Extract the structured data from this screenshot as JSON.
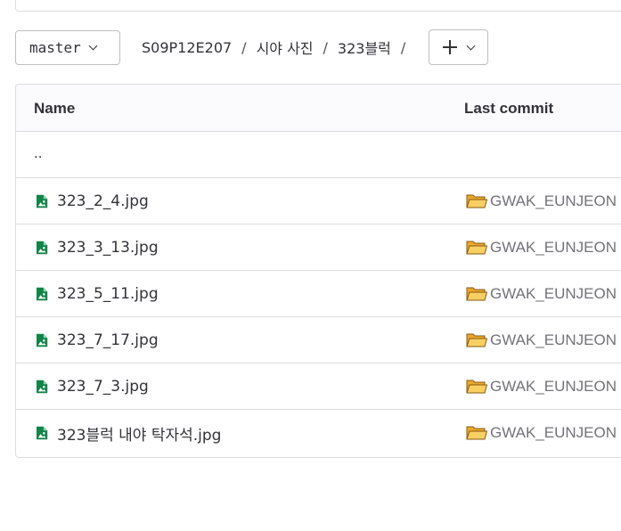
{
  "toolbar": {
    "branch": "master",
    "breadcrumb": [
      "S09P12E207",
      "시야 사진",
      "323블럭"
    ],
    "separator": "/"
  },
  "table": {
    "headers": {
      "name": "Name",
      "last_commit": "Last commit"
    },
    "parent_row": "..",
    "files": [
      {
        "name": "323_2_4.jpg",
        "icon": "image-file-icon",
        "commit": "GWAK_EUNJEON"
      },
      {
        "name": "323_3_13.jpg",
        "icon": "image-file-icon",
        "commit": "GWAK_EUNJEON"
      },
      {
        "name": "323_5_11.jpg",
        "icon": "image-file-icon",
        "commit": "GWAK_EUNJEON"
      },
      {
        "name": "323_7_17.jpg",
        "icon": "image-file-icon",
        "commit": "GWAK_EUNJEON"
      },
      {
        "name": "323_7_3.jpg",
        "icon": "image-file-icon",
        "commit": "GWAK_EUNJEON"
      },
      {
        "name": "323블럭 내야 탁자석.jpg",
        "icon": "image-file-icon",
        "commit": "GWAK_EUNJEON"
      }
    ]
  },
  "colors": {
    "file_icon": "#108548",
    "folder": "#f0b840",
    "border": "#dcdcde",
    "muted_text": "#737278"
  }
}
